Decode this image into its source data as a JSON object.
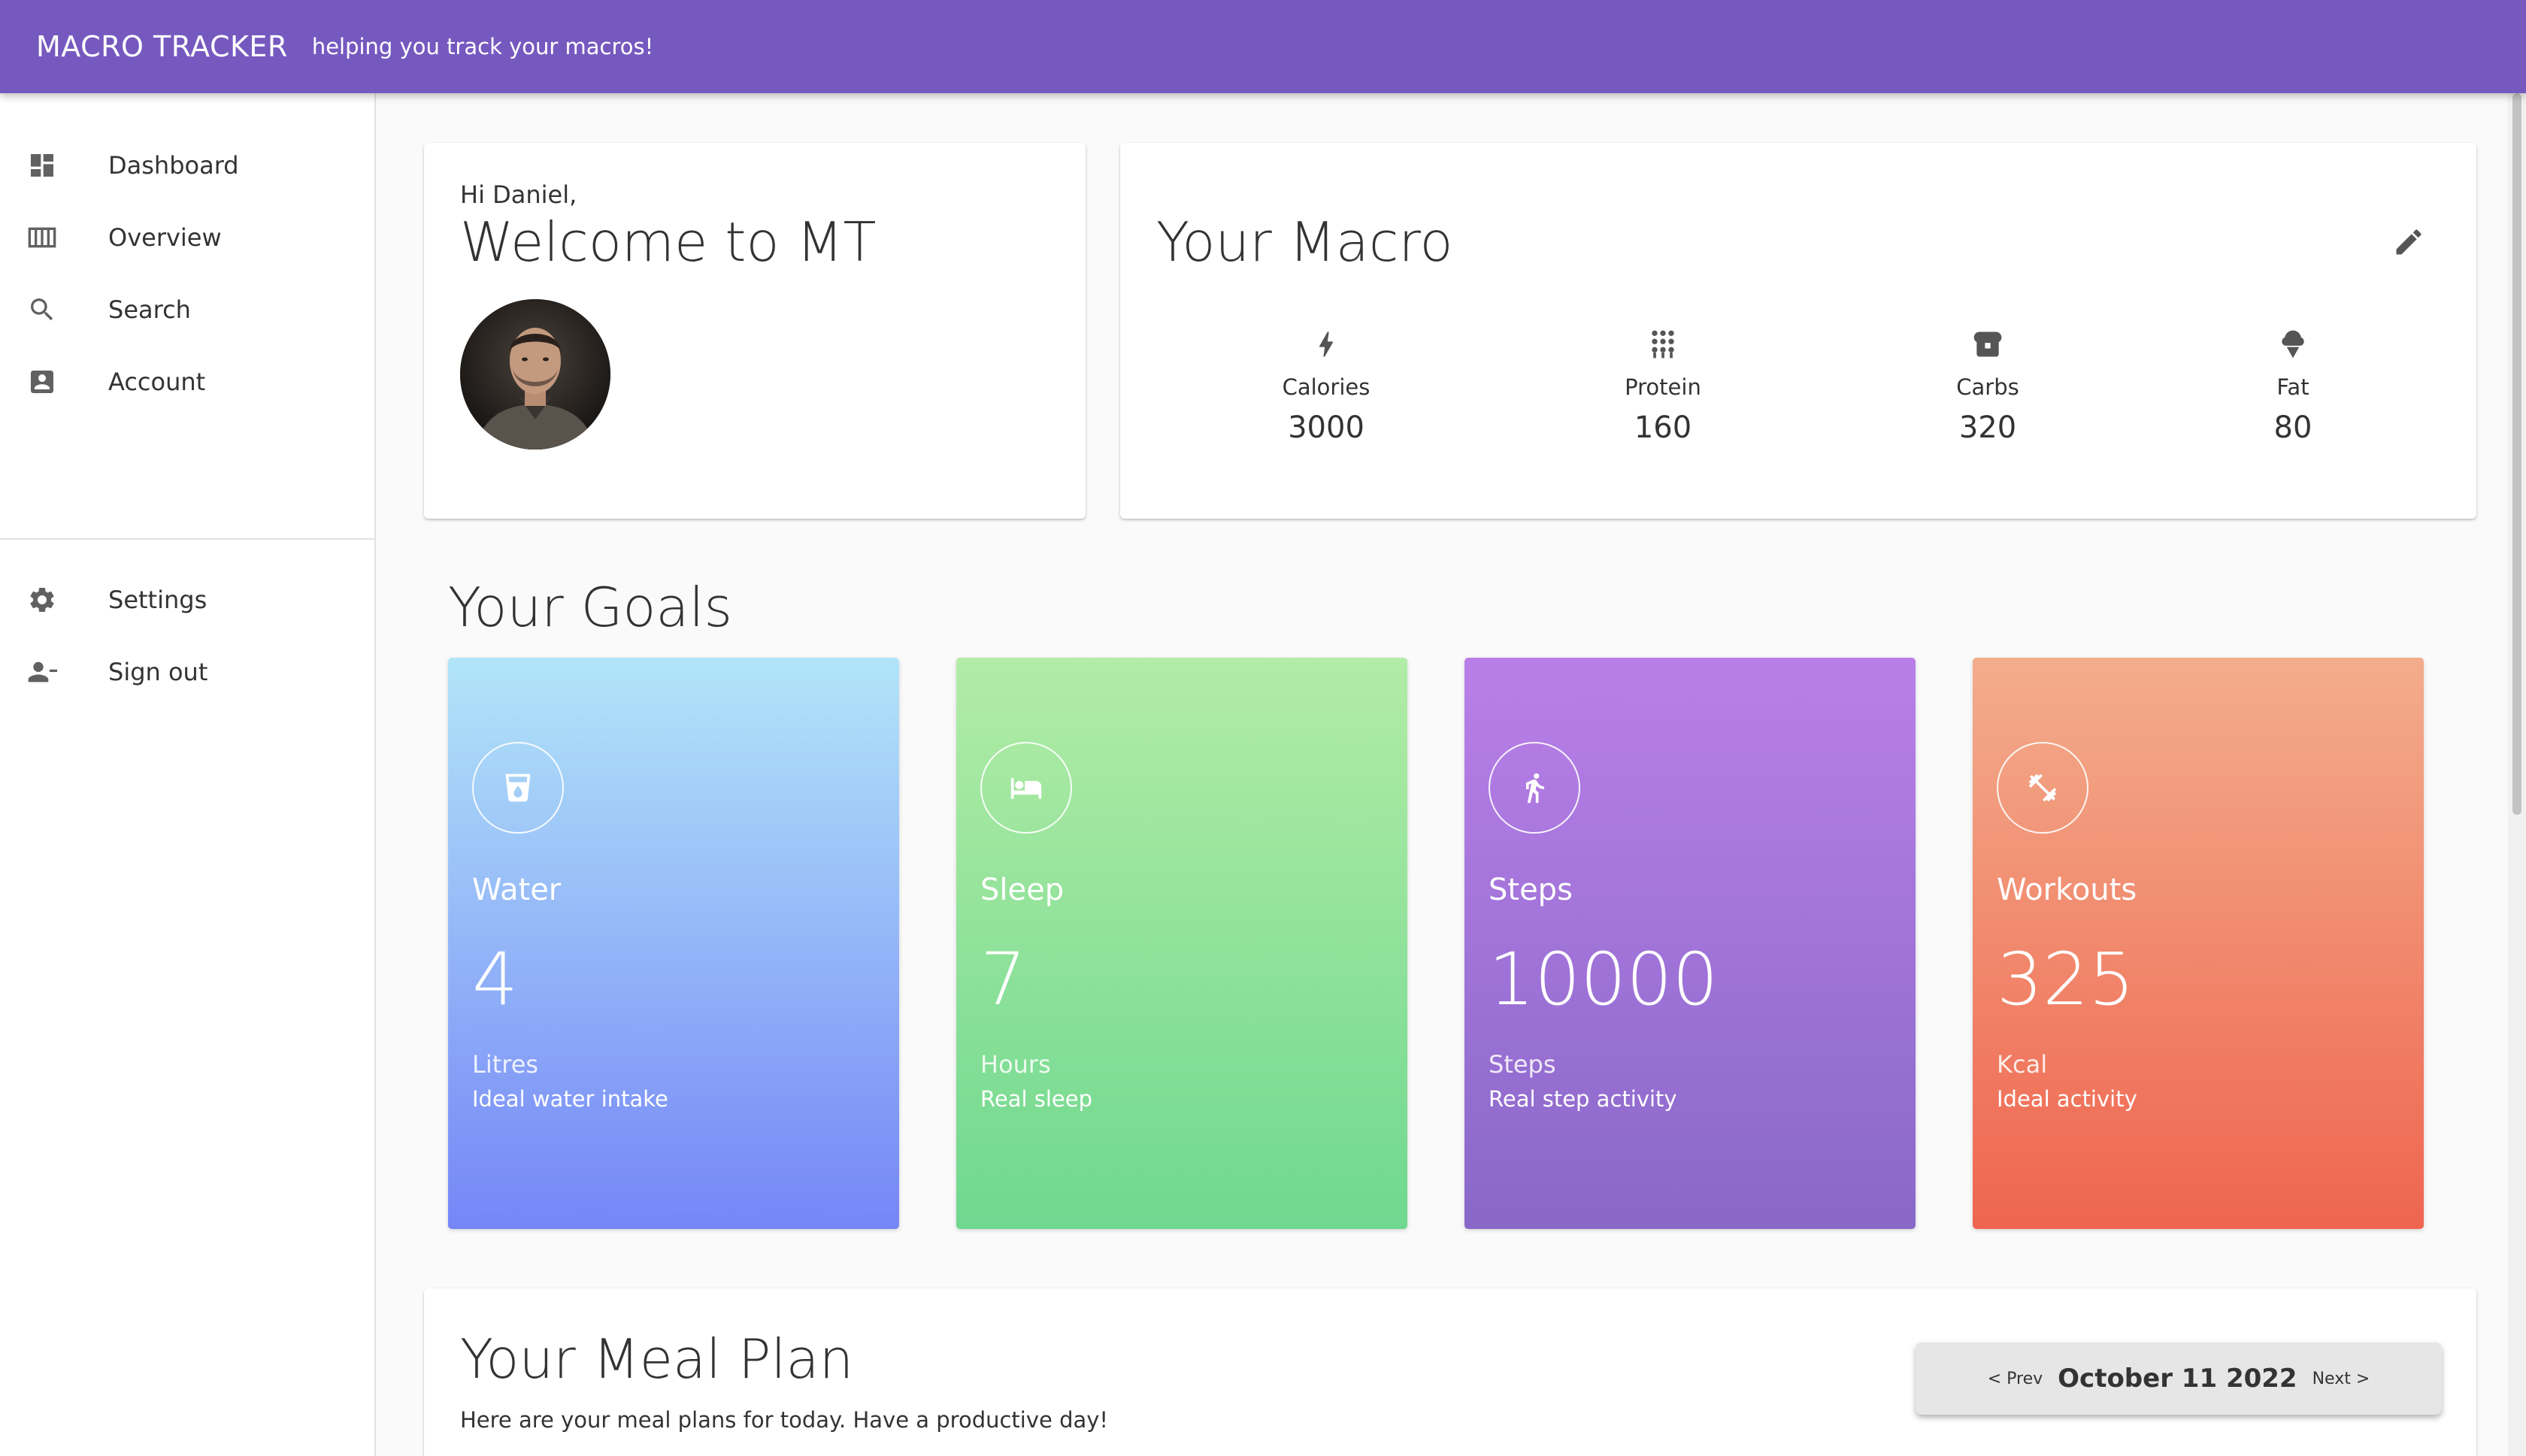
{
  "header": {
    "brand": "MACRO TRACKER",
    "tagline": "helping you track your macros!",
    "background_color": "#7659bf"
  },
  "sidebar": {
    "items": [
      {
        "label": "Dashboard",
        "icon": "dashboard-icon"
      },
      {
        "label": "Overview",
        "icon": "view-columns-icon"
      },
      {
        "label": "Search",
        "icon": "search-icon"
      },
      {
        "label": "Account",
        "icon": "account-box-icon"
      }
    ],
    "bottom_items": [
      {
        "label": "Settings",
        "icon": "gear-icon"
      },
      {
        "label": "Sign out",
        "icon": "person-remove-icon"
      }
    ]
  },
  "welcome": {
    "greeting": "Hi Daniel,",
    "title": "Welcome to MT",
    "avatar_icon": "user-avatar"
  },
  "macro": {
    "title": "Your Macro",
    "edit_icon": "pencil-icon",
    "items": [
      {
        "label": "Calories",
        "value": "3000",
        "icon": "bolt-icon"
      },
      {
        "label": "Protein",
        "value": "160",
        "icon": "grain-icon"
      },
      {
        "label": "Carbs",
        "value": "320",
        "icon": "bread-icon"
      },
      {
        "label": "Fat",
        "value": "80",
        "icon": "ice-cream-icon"
      }
    ]
  },
  "goals": {
    "title": "Your Goals",
    "items": [
      {
        "name": "Water",
        "value": "4",
        "unit": "Litres",
        "desc": "Ideal water intake",
        "icon": "cup-icon",
        "colors": [
          "#b2e5f8",
          "#7586f7"
        ]
      },
      {
        "name": "Sleep",
        "value": "7",
        "unit": "Hours",
        "desc": "Real sleep",
        "icon": "bed-icon",
        "colors": [
          "#b2eca6",
          "#6fd88f"
        ]
      },
      {
        "name": "Steps",
        "value": "10000",
        "unit": "Steps",
        "desc": "Real step activity",
        "icon": "walking-icon",
        "colors": [
          "#b97fe8",
          "#8968c9"
        ]
      },
      {
        "name": "Workouts",
        "value": "325",
        "unit": "Kcal",
        "desc": "Ideal activity",
        "icon": "dumbbell-icon",
        "colors": [
          "#f3ad8c",
          "#ef654f"
        ]
      }
    ]
  },
  "meal_plan": {
    "title": "Your Meal Plan",
    "subtitle": "Here are your meal plans for today. Have a productive day!",
    "prev_label": "< Prev",
    "date": "October 11 2022",
    "next_label": "Next >"
  }
}
